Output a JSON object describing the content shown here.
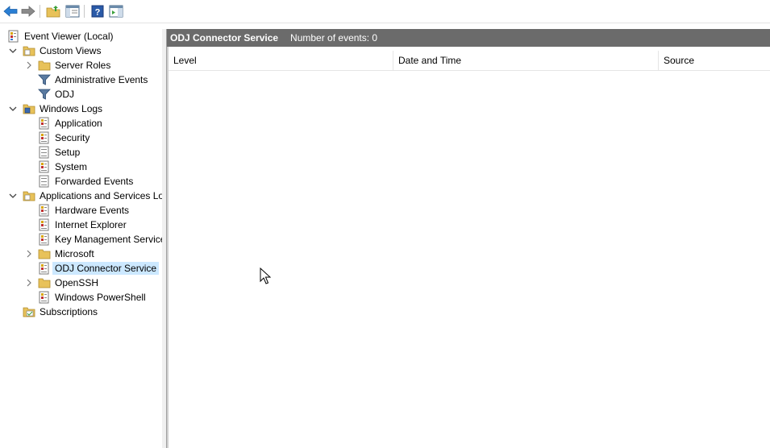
{
  "toolbar": {
    "buttons": [
      {
        "name": "back-arrow-icon"
      },
      {
        "name": "forward-arrow-icon"
      },
      {
        "name": "up-folder-icon"
      },
      {
        "name": "show-hide-console-tree-icon"
      },
      {
        "name": "help-icon"
      },
      {
        "name": "show-hide-action-pane-icon"
      }
    ]
  },
  "tree": {
    "root": "Event Viewer (Local)",
    "custom_views": "Custom Views",
    "server_roles": "Server Roles",
    "administrative_events": "Administrative Events",
    "odj": "ODJ",
    "windows_logs": "Windows Logs",
    "application": "Application",
    "security": "Security",
    "setup": "Setup",
    "system": "System",
    "forwarded_events": "Forwarded Events",
    "apps_services": "Applications and Services Lo",
    "hardware_events": "Hardware Events",
    "internet_explorer": "Internet Explorer",
    "key_management": "Key Management Service",
    "microsoft": "Microsoft",
    "odj_connector": "ODJ Connector Service",
    "openssh": "OpenSSH",
    "windows_powershell": "Windows PowerShell",
    "subscriptions": "Subscriptions"
  },
  "main": {
    "title": "ODJ Connector Service",
    "event_count": "Number of events: 0",
    "columns": [
      "Level",
      "Date and Time",
      "Source"
    ]
  },
  "colors": {
    "header_bar": "#6b6b6b",
    "selection": "#cce8ff",
    "folder": "#e8c25a",
    "arrow_blue": "#2a7fd4"
  }
}
